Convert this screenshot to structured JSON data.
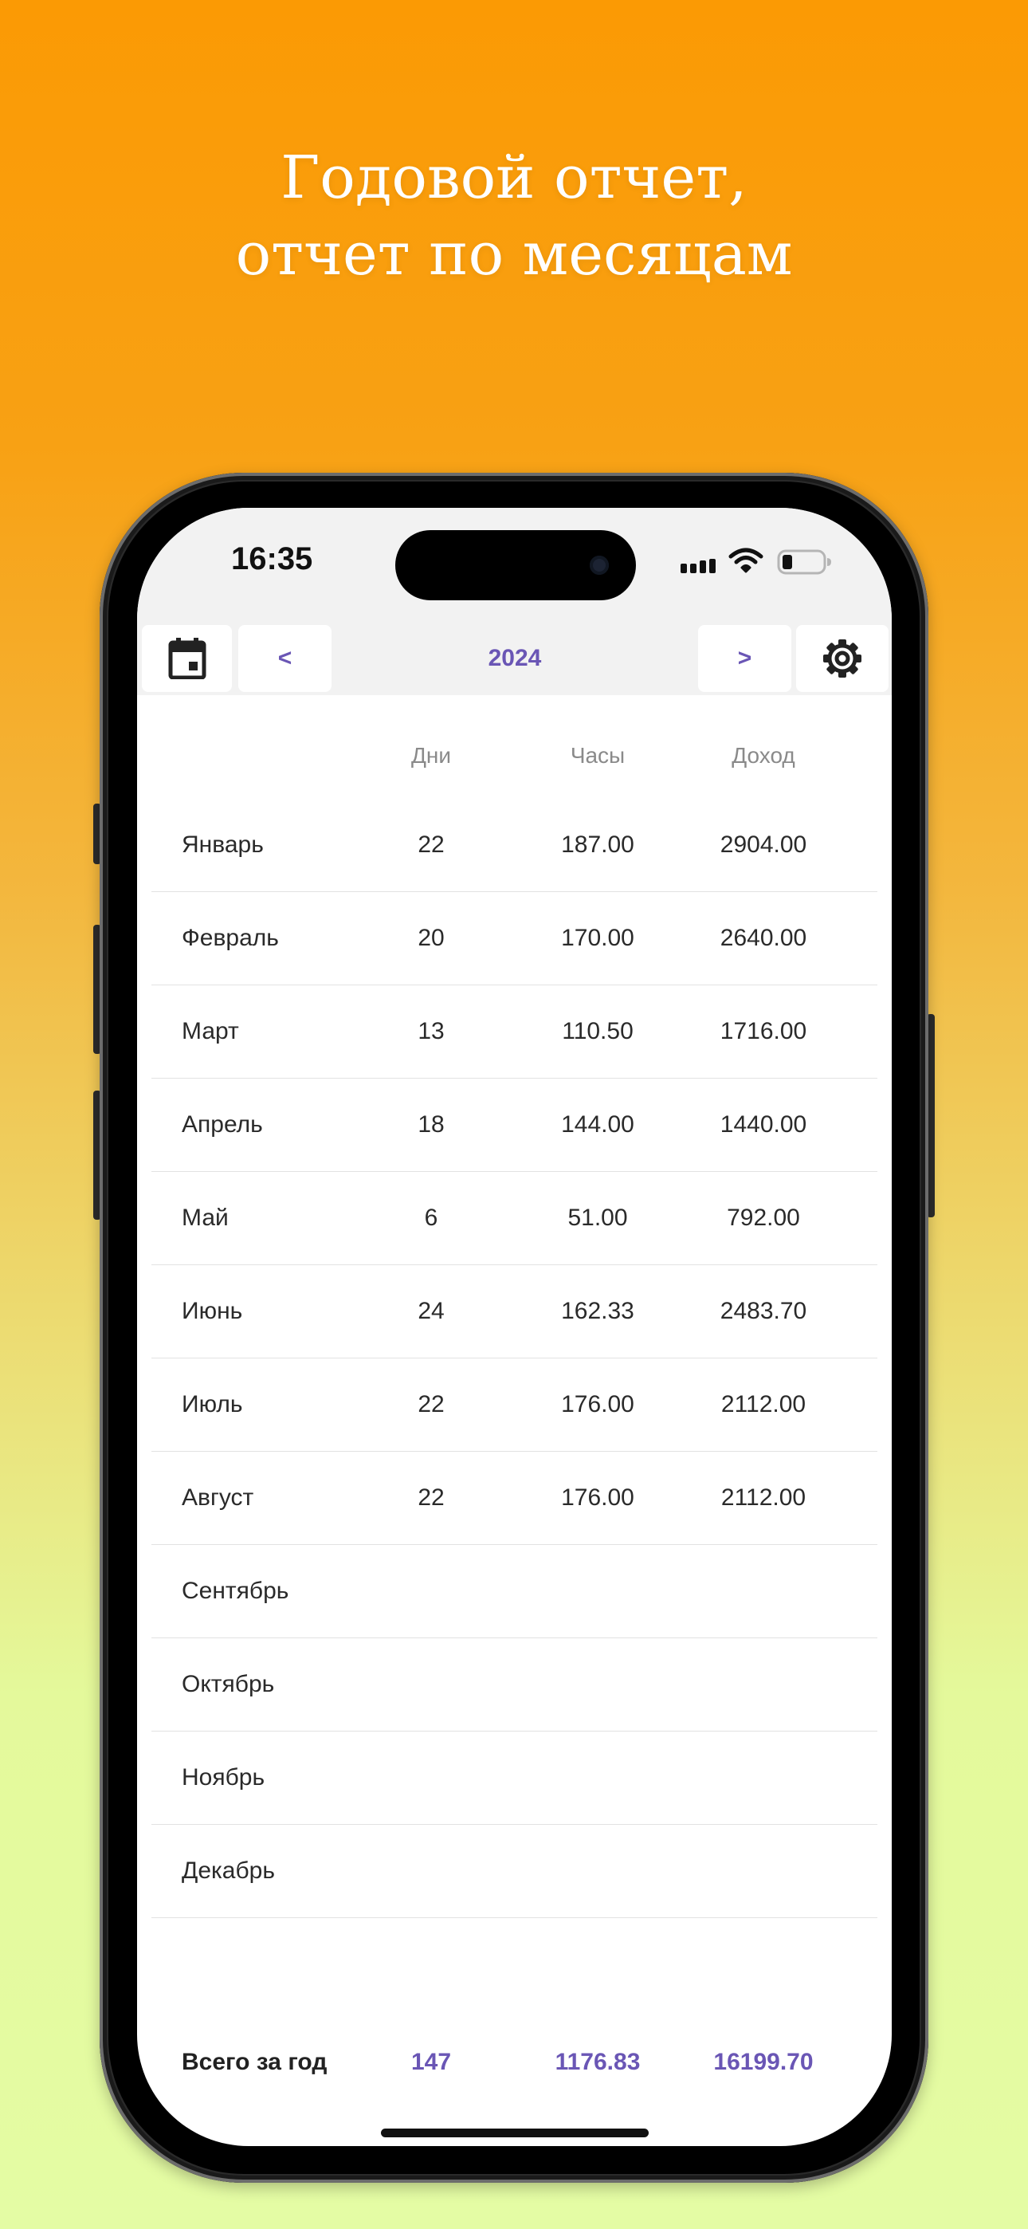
{
  "promo": {
    "line1": "Годовой отчет,",
    "line2": "отчет по месяцам",
    "background_top": "#fb9a04",
    "background_bottom": "#e4fca4",
    "text_color": "#ffffff"
  },
  "status_bar": {
    "time": "16:35",
    "icons": [
      "cellular-signal-icon",
      "wifi-icon",
      "battery-icon"
    ]
  },
  "toolbar": {
    "calendar_icon": "calendar-icon",
    "prev_label": "<",
    "year": "2024",
    "next_label": ">",
    "settings_icon": "gear-icon",
    "accent_color": "#6a56b5"
  },
  "table": {
    "headers": {
      "days": "Дни",
      "hours": "Часы",
      "income": "Доход"
    },
    "rows": [
      {
        "month": "Январь",
        "days": "22",
        "hours": "187.00",
        "income": "2904.00"
      },
      {
        "month": "Февраль",
        "days": "20",
        "hours": "170.00",
        "income": "2640.00"
      },
      {
        "month": "Март",
        "days": "13",
        "hours": "110.50",
        "income": "1716.00"
      },
      {
        "month": "Апрель",
        "days": "18",
        "hours": "144.00",
        "income": "1440.00"
      },
      {
        "month": "Май",
        "days": "6",
        "hours": "51.00",
        "income": "792.00"
      },
      {
        "month": "Июнь",
        "days": "24",
        "hours": "162.33",
        "income": "2483.70"
      },
      {
        "month": "Июль",
        "days": "22",
        "hours": "176.00",
        "income": "2112.00"
      },
      {
        "month": "Август",
        "days": "22",
        "hours": "176.00",
        "income": "2112.00"
      },
      {
        "month": "Сентябрь",
        "days": "",
        "hours": "",
        "income": ""
      },
      {
        "month": "Октябрь",
        "days": "",
        "hours": "",
        "income": ""
      },
      {
        "month": "Ноябрь",
        "days": "",
        "hours": "",
        "income": ""
      },
      {
        "month": "Декабрь",
        "days": "",
        "hours": "",
        "income": ""
      }
    ],
    "total": {
      "label": "Всего за год",
      "days": "147",
      "hours": "1176.83",
      "income": "16199.70"
    }
  }
}
